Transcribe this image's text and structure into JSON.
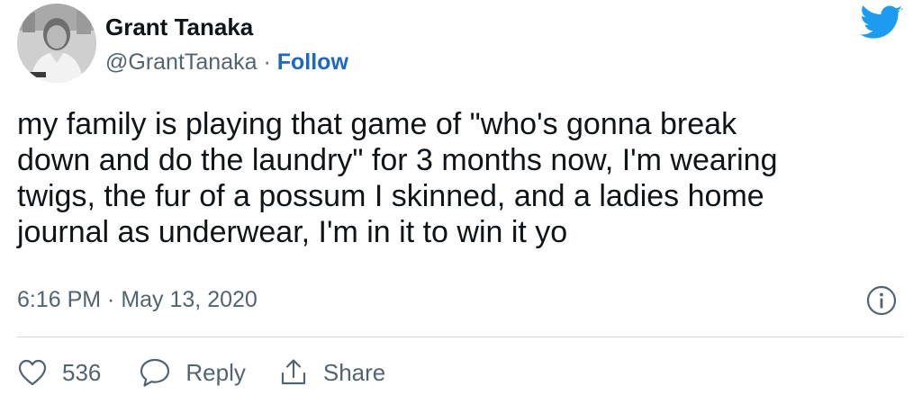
{
  "author": {
    "name": "Grant Tanaka",
    "handle": "@GrantTanaka",
    "separator": " · ",
    "follow_label": "Follow"
  },
  "tweet": {
    "text": "my family is playing that game of \"who's gonna break\ndown and do the laundry\" for 3 months now, I'm wearing\ntwigs, the fur of a possum I skinned, and a ladies home\njournal as underwear, I'm in it to win it yo",
    "time": "6:16 PM",
    "date_separator": " · ",
    "date": "May 13, 2020"
  },
  "actions": {
    "like_count": "536",
    "reply_label": "Reply",
    "share_label": "Share"
  },
  "icons": {
    "brand": "twitter-bird-icon",
    "info": "info-icon",
    "like": "heart-icon",
    "reply": "speech-bubble-icon",
    "share": "share-icon"
  },
  "colors": {
    "brand_blue": "#1d9bf0",
    "follow_blue": "#1d68c4",
    "secondary_text": "#536471",
    "primary_text": "#0f1419",
    "divider": "#cfd9de"
  }
}
